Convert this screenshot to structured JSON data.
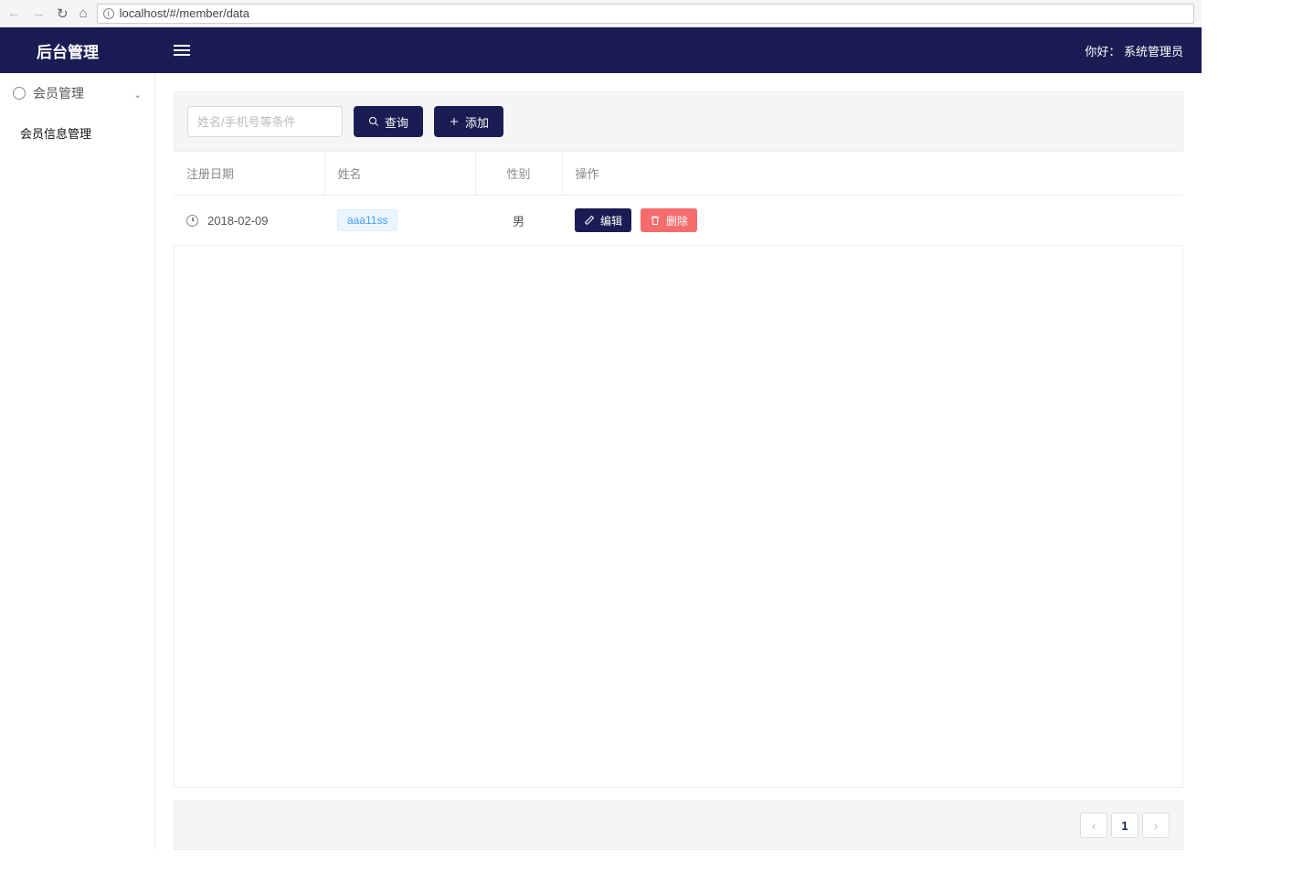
{
  "browser": {
    "url": "localhost/#/member/data"
  },
  "header": {
    "title": "后台管理",
    "greeting_prefix": "你好：",
    "username": "系统管理员"
  },
  "sidebar": {
    "group_label": "会员管理",
    "items": [
      {
        "label": "会员信息管理"
      }
    ]
  },
  "toolbar": {
    "search_placeholder": "姓名/手机号等条件",
    "query_label": "查询",
    "add_label": "添加"
  },
  "table": {
    "columns": [
      "注册日期",
      "姓名",
      "性别",
      "操作"
    ],
    "rows": [
      {
        "date": "2018-02-09",
        "name": "aaa11ss",
        "gender": "男",
        "edit_label": "编辑",
        "delete_label": "删除"
      }
    ]
  },
  "pagination": {
    "current": "1"
  }
}
